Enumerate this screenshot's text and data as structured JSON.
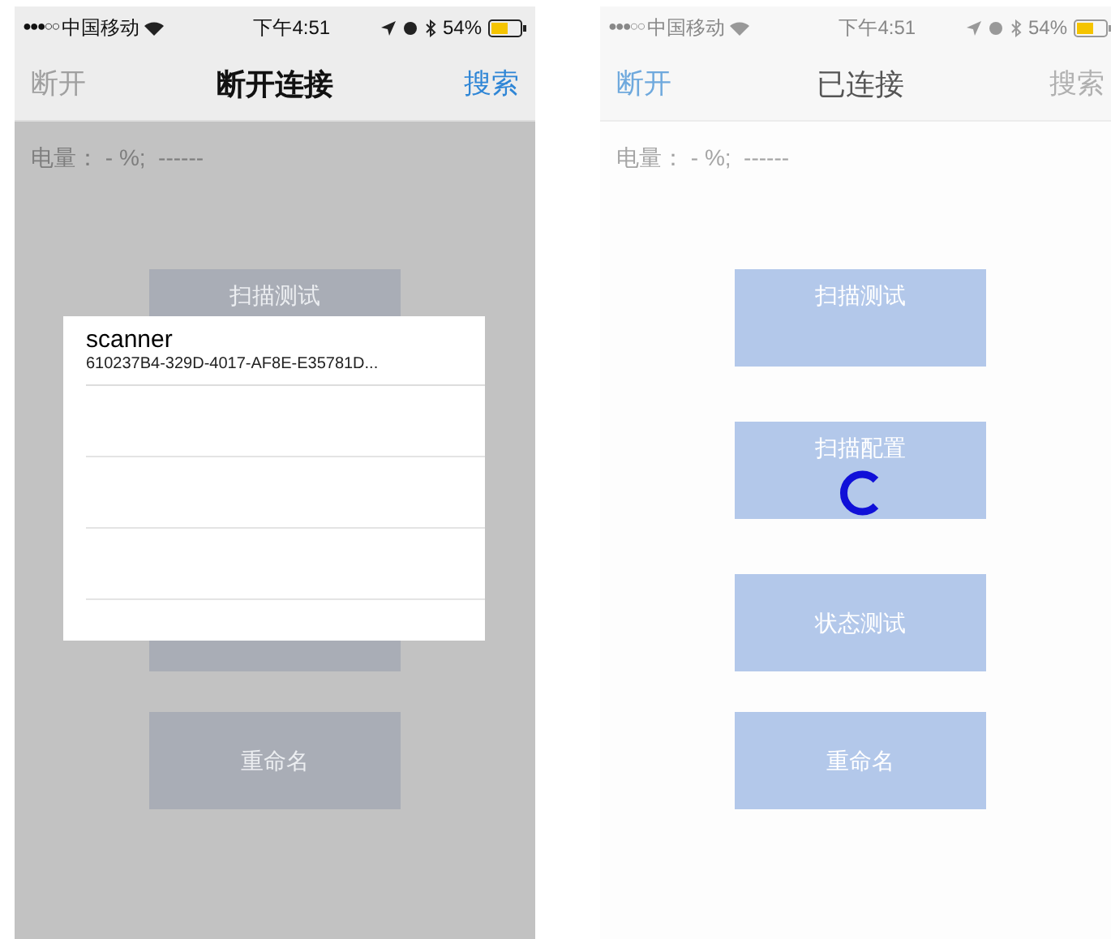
{
  "screens": [
    {
      "dimmed": true,
      "loading": false,
      "status_bar": {
        "signal": "●●●○○",
        "carrier": "中国移动",
        "time": "下午4:51",
        "battery": "54%"
      },
      "nav": {
        "left": {
          "label": "断开",
          "disabled": true
        },
        "title": "断开连接",
        "right": {
          "label": "搜索",
          "disabled": false
        }
      },
      "battery_info": "电量： - %;  ------",
      "buttons": [
        {
          "kind": "button",
          "label": "扫描测试"
        },
        {
          "kind": "covered"
        },
        {
          "kind": "covered"
        },
        {
          "kind": "button",
          "label": "重命名"
        }
      ],
      "device_list": {
        "devices": [
          {
            "name": "scanner",
            "uuid": "610237B4-329D-4017-AF8E-E35781D..."
          }
        ]
      }
    },
    {
      "dimmed": false,
      "loading": true,
      "status_bar": {
        "signal": "●●●○○",
        "carrier": "中国移动",
        "time": "下午4:51",
        "battery": "54%"
      },
      "nav": {
        "left": {
          "label": "断开",
          "disabled": false
        },
        "title": "已连接",
        "right": {
          "label": "搜索",
          "disabled": true
        }
      },
      "battery_info": "电量： - %;  ------",
      "buttons": [
        {
          "kind": "button",
          "label": "扫描测试"
        },
        {
          "kind": "button",
          "label": "扫描配置"
        },
        {
          "kind": "button",
          "label": "状态测试"
        },
        {
          "kind": "button",
          "label": "重命名"
        }
      ]
    }
  ]
}
